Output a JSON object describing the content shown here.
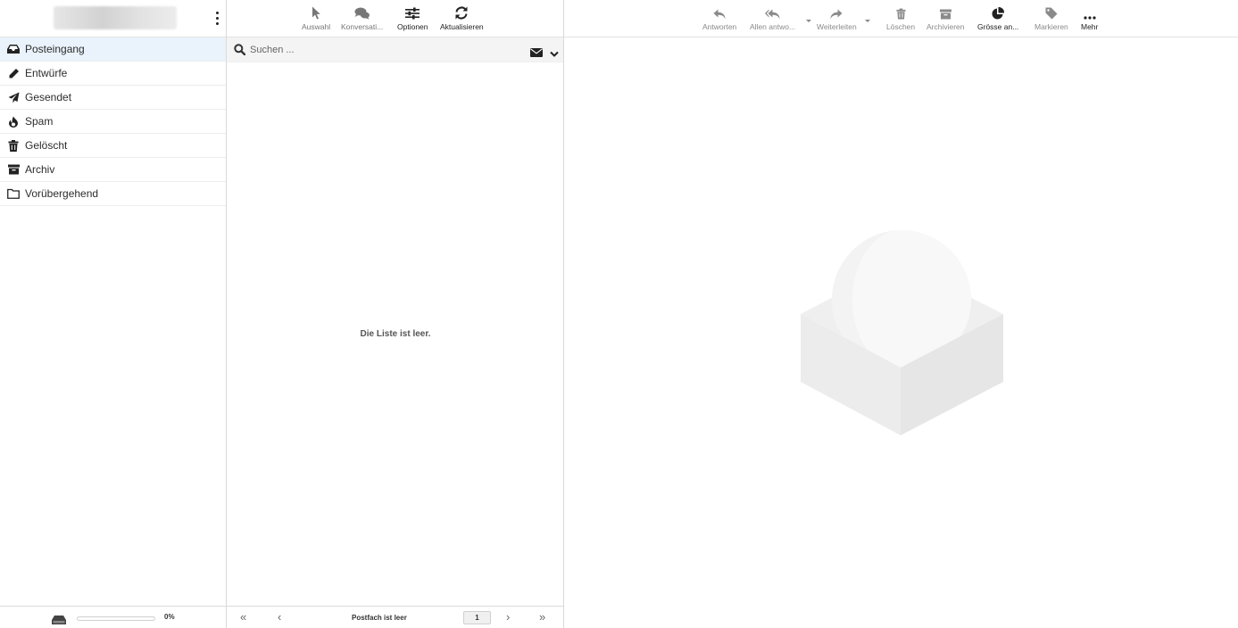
{
  "folders": {
    "items": [
      {
        "label": "Posteingang",
        "icon": "inbox-icon",
        "selected": true
      },
      {
        "label": "Entwürfe",
        "icon": "pencil-icon"
      },
      {
        "label": "Gesendet",
        "icon": "paper-plane-icon"
      },
      {
        "label": "Spam",
        "icon": "fire-icon"
      },
      {
        "label": "Gelöscht",
        "icon": "trash-icon"
      },
      {
        "label": "Archiv",
        "icon": "archive-icon"
      },
      {
        "label": "Vorübergehend",
        "icon": "folder-icon"
      }
    ]
  },
  "quota": {
    "percent_text": "0%",
    "fill_fraction": 0.0
  },
  "list_toolbar": {
    "select": "Auswahl",
    "threads": "Konversati...",
    "options": "Optionen",
    "refresh": "Aktualisieren"
  },
  "search": {
    "placeholder": "Suchen ..."
  },
  "message_list": {
    "empty_text": "Die Liste ist leer."
  },
  "pager": {
    "status": "Postfach ist leer",
    "page": "1"
  },
  "preview_toolbar": {
    "reply": "Antworten",
    "reply_all": "Allen antwo...",
    "forward": "Weiterleiten",
    "delete": "Löschen",
    "archive": "Archivieren",
    "size": "Grösse an...",
    "mark": "Markieren",
    "more": "Mehr"
  },
  "colors": {
    "selected_folder_bg": "#eaf3fb",
    "accent": "#37beff"
  }
}
